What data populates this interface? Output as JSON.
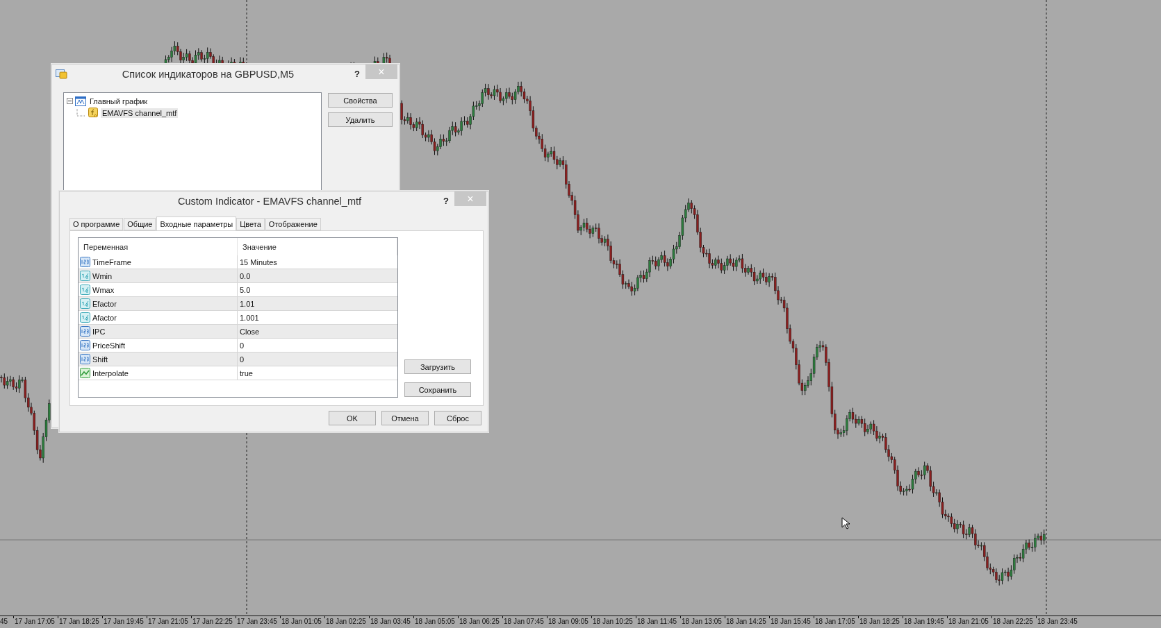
{
  "chart": {
    "time_labels": [
      "45",
      "17 Jan 17:05",
      "17 Jan 18:25",
      "17 Jan 19:45",
      "17 Jan 21:05",
      "17 Jan 22:25",
      "17 Jan 23:45",
      "18 Jan 01:05",
      "18 Jan 02:25",
      "18 Jan 03:45",
      "18 Jan 05:05",
      "18 Jan 06:25",
      "18 Jan 07:45",
      "18 Jan 09:05",
      "18 Jan 10:25",
      "18 Jan 11:45",
      "18 Jan 13:05",
      "18 Jan 14:25",
      "18 Jan 15:45",
      "18 Jan 17:05",
      "18 Jan 18:25",
      "18 Jan 19:45",
      "18 Jan 21:05",
      "18 Jan 22:25",
      "18 Jan 23:45"
    ]
  },
  "indicator_list_dialog": {
    "title": "Список индикаторов на GBPUSD,M5",
    "help_button": "?",
    "close_button": "×",
    "tree": [
      {
        "label": "Главный график",
        "expanded": true,
        "selected": false,
        "children": [
          {
            "label": "EMAVFS channel_mtf",
            "selected": true
          }
        ]
      }
    ],
    "buttons": [
      "Свойства",
      "Удалить"
    ]
  },
  "properties_dialog": {
    "title": "Custom Indicator - EMAVFS channel_mtf",
    "help_button": "?",
    "close_button": "×",
    "tabs": [
      {
        "label": "О программе",
        "selected": false
      },
      {
        "label": "Общие",
        "selected": false
      },
      {
        "label": "Входные параметры",
        "selected": true
      },
      {
        "label": "Цвета",
        "selected": false
      },
      {
        "label": "Отображение",
        "selected": false
      }
    ],
    "table": {
      "columns": [
        "Переменная",
        "Значение"
      ],
      "rows": [
        {
          "kind": "int",
          "name": "TimeFrame",
          "value": "15 Minutes"
        },
        {
          "kind": "double",
          "name": "Wmin",
          "value": "0.0"
        },
        {
          "kind": "double",
          "name": "Wmax",
          "value": "5.0"
        },
        {
          "kind": "double",
          "name": "Efactor",
          "value": "1.01"
        },
        {
          "kind": "double",
          "name": "Afactor",
          "value": "1.001"
        },
        {
          "kind": "int",
          "name": "IPC",
          "value": "Close"
        },
        {
          "kind": "int",
          "name": "PriceShift",
          "value": "0"
        },
        {
          "kind": "int",
          "name": "Shift",
          "value": "0"
        },
        {
          "kind": "bool",
          "name": "Interpolate",
          "value": "true"
        }
      ]
    },
    "side_buttons": [
      "Загрузить",
      "Сохранить"
    ],
    "footer_buttons": [
      "OK",
      "Отмена",
      "Сброс"
    ]
  }
}
